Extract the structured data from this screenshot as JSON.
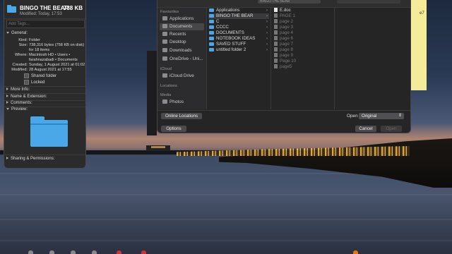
{
  "info_window": {
    "title": "BINGO THE BEAR",
    "size": "738 KB",
    "modified": "Modified: Today, 17:53",
    "tags_placeholder": "Add Tags...",
    "general_label": "General:",
    "general": [
      {
        "key": "Kind:",
        "value": "Folder"
      },
      {
        "key": "Size:",
        "value": "738,316 bytes (758 KB on disk)"
      },
      {
        "key": "",
        "value": "for 18 items"
      },
      {
        "key": "Where:",
        "value": "Macintosh HD • Users •"
      },
      {
        "key": "",
        "value": "farahnazabadi • Documents"
      },
      {
        "key": "Created:",
        "value": "Sunday, 1 August 2021 at 01:02"
      },
      {
        "key": "Modified:",
        "value": "28 August 2021 at 17:55"
      }
    ],
    "shared_folder": "Shared folder",
    "locked": "Locked",
    "more_info": "More Info:",
    "name_ext": "Name & Extension:",
    "comments": "Comments:",
    "preview": "Preview:",
    "sharing": "Sharing & Permissions:"
  },
  "dialog": {
    "path_label": "BINGO THE BEAR",
    "sidebar": {
      "favourites": "Favourites",
      "items": [
        "Applications",
        "Documents",
        "Recents",
        "Desktop",
        "Downloads",
        "OneDrive - Uni..."
      ],
      "icloud_label": "iCloud",
      "icloud_drive": "iCloud Drive",
      "locations": "Locations",
      "media": "Media",
      "photos": "Photos"
    },
    "column1": [
      "Applications",
      "BINGO THE BEAR",
      "C",
      "CCCC",
      "DOCUMENTS",
      "NOTEBOOK IDEAS",
      "SAVED STUFF",
      "untitled folder 2"
    ],
    "column2": [
      {
        "name": "E.doc",
        "dim": false
      },
      {
        "name": "PAGE 1",
        "dim": true
      },
      {
        "name": "page 2",
        "dim": true
      },
      {
        "name": "page 3",
        "dim": true
      },
      {
        "name": "page 4",
        "dim": true
      },
      {
        "name": "page 6",
        "dim": true
      },
      {
        "name": "page 7",
        "dim": true
      },
      {
        "name": "page 8",
        "dim": true
      },
      {
        "name": "page 9",
        "dim": true
      },
      {
        "name": "Page 10",
        "dim": true
      },
      {
        "name": "page5",
        "dim": true
      }
    ],
    "online_locations": "Online Locations",
    "open_label": "Open",
    "open_option": "Original",
    "options": "Options",
    "cancel": "Cancel",
    "open": "Open"
  },
  "sticky_note": "e7"
}
